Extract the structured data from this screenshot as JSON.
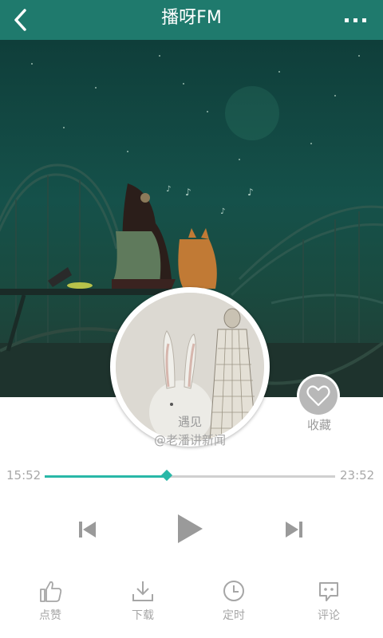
{
  "header": {
    "title": "播呀FM"
  },
  "track": {
    "title": "遇见",
    "author": "@老潘讲新闻",
    "elapsed": "15:52",
    "total": "23:52",
    "progress_fraction": 0.42
  },
  "favorite": {
    "label": "收藏"
  },
  "bottom_bar": {
    "items": [
      {
        "label": "点赞",
        "icon": "thumbs-up-icon"
      },
      {
        "label": "下载",
        "icon": "download-icon"
      },
      {
        "label": "定时",
        "icon": "clock-icon"
      },
      {
        "label": "评论",
        "icon": "comment-icon"
      }
    ]
  },
  "colors": {
    "header_bg": "#1f7a6d",
    "accent": "#29b8a8",
    "icon_gray": "#a6a6a6"
  }
}
